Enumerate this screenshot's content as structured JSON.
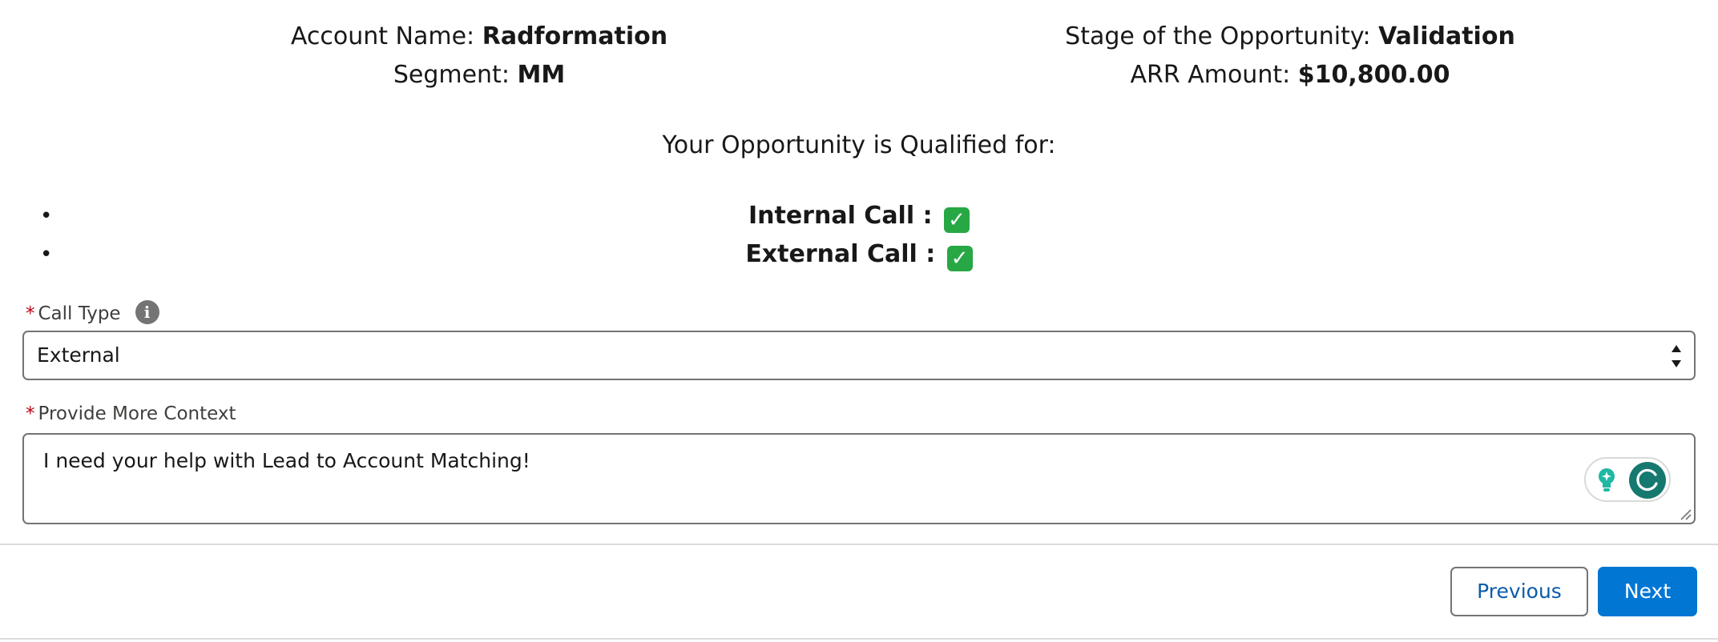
{
  "summary": {
    "account_label": "Account Name: ",
    "account_value": "Radformation",
    "segment_label": "Segment: ",
    "segment_value": "MM",
    "stage_label": "Stage of the Opportunity: ",
    "stage_value": "Validation",
    "arr_label": "ARR Amount: ",
    "arr_value": "$10,800.00"
  },
  "qualification": {
    "title": "Your Opportunity is Qualified for:",
    "items": [
      {
        "label": "Internal Call : ",
        "status_icon": "check-mark-emoji"
      },
      {
        "label": "External Call : ",
        "status_icon": "check-mark-emoji"
      }
    ]
  },
  "call_type": {
    "label": "Call Type",
    "required_marker": "*",
    "value": "External"
  },
  "context": {
    "label": "Provide More Context",
    "required_marker": "*",
    "value": "I need your help with Lead to Account Matching!"
  },
  "footer": {
    "previous_label": "Previous",
    "next_label": "Next"
  },
  "colors": {
    "brand_blue": "#0176d3",
    "required_red": "#ba0517",
    "check_green": "#27a844",
    "grammar_green": "#16796f"
  }
}
